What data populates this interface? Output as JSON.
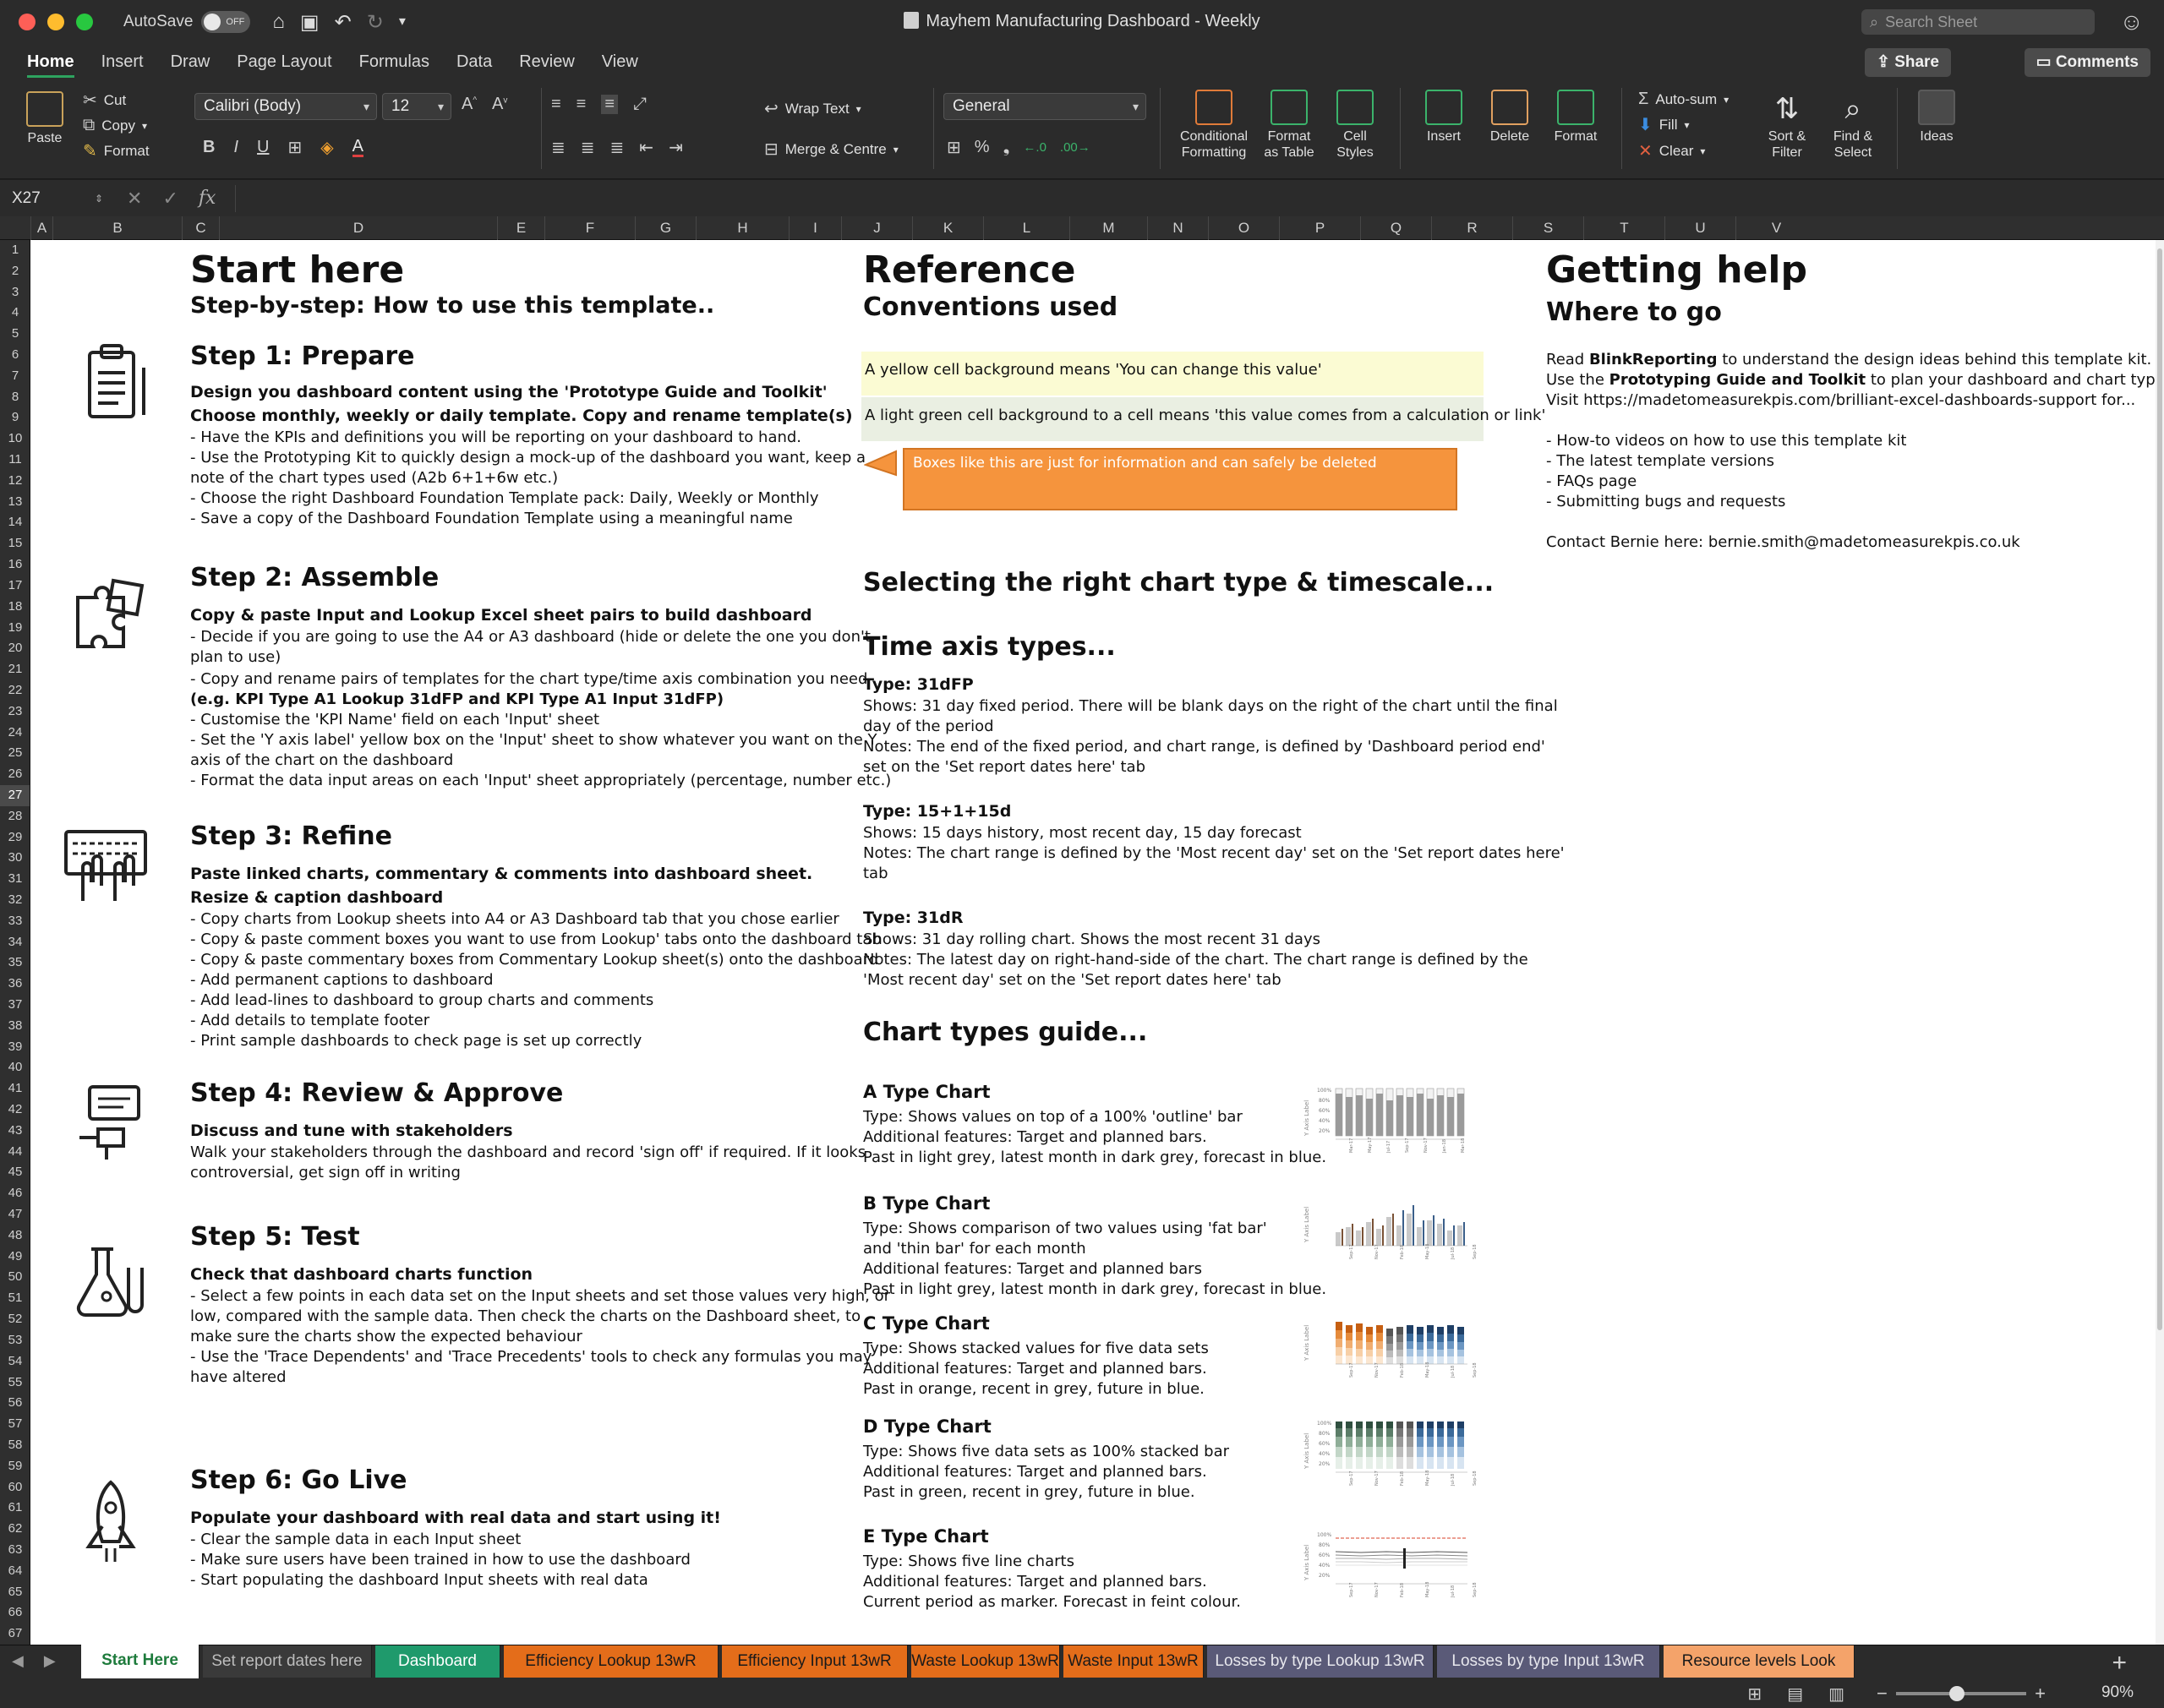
{
  "window": {
    "title": "Mayhem Manufacturing Dashboard - Weekly",
    "autosave_label": "AutoSave",
    "autosave_state": "OFF",
    "search_placeholder": "Search Sheet"
  },
  "ribbon_tabs": [
    "Home",
    "Insert",
    "Draw",
    "Page Layout",
    "Formulas",
    "Data",
    "Review",
    "View"
  ],
  "ribbon_buttons": {
    "share": "Share",
    "comments": "Comments"
  },
  "ribbon": {
    "paste": "Paste",
    "cut": "Cut",
    "copy": "Copy",
    "format_painter": "Format",
    "font_name": "Calibri (Body)",
    "font_size": "12",
    "wrap_text": "Wrap Text",
    "merge_centre": "Merge & Centre",
    "number_format": "General",
    "percent": "%",
    "conditional_formatting": "Conditional\nFormatting",
    "conditional_formatting_l1": "Conditional",
    "conditional_formatting_l2": "Formatting",
    "format_as_table_l1": "Format",
    "format_as_table_l2": "as Table",
    "cell_styles_l1": "Cell",
    "cell_styles_l2": "Styles",
    "insert": "Insert",
    "delete": "Delete",
    "format": "Format",
    "autosum": "Auto-sum",
    "fill": "Fill",
    "clear": "Clear",
    "sort_filter_l1": "Sort &",
    "sort_filter_l2": "Filter",
    "find_select_l1": "Find &",
    "find_select_l2": "Select",
    "ideas": "Ideas"
  },
  "formula_bar": {
    "name_box": "X27",
    "fx": "fx",
    "formula": ""
  },
  "columns": [
    "A",
    "B",
    "C",
    "D",
    "E",
    "F",
    "G",
    "H",
    "I",
    "J",
    "K",
    "L",
    "M",
    "N",
    "O",
    "P",
    "Q",
    "R",
    "S",
    "T",
    "U",
    "V"
  ],
  "rows": [
    "1",
    "2",
    "3",
    "4",
    "5",
    "6",
    "7",
    "8",
    "9",
    "10",
    "11",
    "12",
    "13",
    "14",
    "15",
    "16",
    "17",
    "18",
    "19",
    "20",
    "21",
    "22",
    "23",
    "24",
    "25",
    "26",
    "27",
    "28",
    "29",
    "30",
    "31",
    "32",
    "33",
    "34",
    "35",
    "36",
    "37",
    "38",
    "39",
    "40",
    "41",
    "42",
    "43",
    "44",
    "45",
    "46",
    "47",
    "48",
    "49",
    "50",
    "51",
    "52",
    "53",
    "54",
    "55",
    "56",
    "57",
    "58",
    "59",
    "60",
    "61",
    "62",
    "63",
    "64",
    "65",
    "66",
    "67"
  ],
  "start": {
    "title": "Start here",
    "subtitle": "Step-by-step: How to use this template..",
    "steps": [
      {
        "title": "Step 1: Prepare",
        "bold_lines": [
          "Design you dashboard content using the 'Prototype Guide and Toolkit'",
          "Choose monthly, weekly or daily template. Copy and rename template(s)"
        ],
        "lines": [
          "- Have the KPIs and definitions you will be reporting on your dashboard to hand.",
          "- Use the Prototyping Kit to quickly design a mock-up of the dashboard you want, keep a",
          "note of the chart types used (A2b 6+1+6w etc.)",
          "- Choose the right Dashboard Foundation Template pack: Daily, Weekly or Monthly",
          "- Save a copy of the Dashboard Foundation Template using a meaningful name"
        ]
      },
      {
        "title": "Step 2: Assemble",
        "bold_lines": [
          "Copy & paste Input and Lookup Excel sheet pairs to build dashboard"
        ],
        "lines": [
          "- Decide if you are going to use the A4 or A3 dashboard (hide or delete the one you don't",
          "plan to use)",
          "- Copy and rename pairs of templates for the chart type/time axis combination you need",
          "(e.g. KPI Type A1 Lookup 31dFP and KPI Type A1 Input 31dFP)",
          "- Customise the 'KPI Name' field on each 'Input' sheet",
          "- Set the 'Y axis label' yellow box on the 'Input' sheet to show whatever you want on the Y",
          "axis of the chart on the dashboard",
          "- Format the data input areas on each 'Input' sheet appropriately (percentage, number etc.)"
        ]
      },
      {
        "title": "Step 3: Refine",
        "bold_lines": [
          "Paste linked charts, commentary & comments into dashboard sheet.",
          "Resize & caption dashboard"
        ],
        "lines": [
          "- Copy charts from Lookup sheets into A4 or A3 Dashboard tab that you chose earlier",
          "- Copy & paste comment boxes you want to use from  Lookup' tabs onto the dashboard tab",
          "- Copy & paste  commentary boxes from  Commentary Lookup sheet(s) onto the dashboard",
          "- Add permanent captions to dashboard",
          "- Add lead-lines to dashboard to group charts and comments",
          "- Add details to template footer",
          "- Print sample dashboards to check page is set up correctly"
        ]
      },
      {
        "title": "Step 4: Review & Approve",
        "bold_lines": [
          "Discuss and tune with stakeholders"
        ],
        "lines": [
          "Walk your stakeholders through the dashboard and record 'sign off' if required. If it looks",
          "controversial, get sign off in writing"
        ]
      },
      {
        "title": "Step 5: Test",
        "bold_lines": [
          "Check that dashboard charts function"
        ],
        "lines": [
          "- Select a few points in each data set on the Input sheets and set those values very high, or",
          "low, compared with the sample data. Then check the charts on the Dashboard sheet, to",
          "make sure the charts show the expected behaviour",
          "- Use the 'Trace Dependents' and 'Trace Precedents' tools to check any formulas you may",
          "have altered"
        ]
      },
      {
        "title": "Step 6: Go Live",
        "bold_lines": [
          "Populate your dashboard with real data and start using it!"
        ],
        "lines": [
          "- Clear the sample data in each Input sheet",
          "- Make sure users have been trained in how to use the dashboard",
          "- Start populating the dashboard Input sheets with real data"
        ]
      }
    ]
  },
  "reference": {
    "title": "Reference",
    "subtitle": "Conventions used",
    "yellow_text": "A yellow cell background means 'You can change this value'",
    "green_text": "A light green cell background to a cell means 'this value comes from a calculation or link'",
    "callout_text": "Boxes like this are just for information and can safely be deleted",
    "selecting_title": "Selecting the right chart type & timescale...",
    "time_axis_title": "Time axis types...",
    "time_axis": [
      {
        "type_label": "Type: 31dFP",
        "shows_lines": [
          "Shows: 31 day fixed period. There will be blank days on the right of the chart until the final",
          "day of the period"
        ],
        "notes_lines": [
          "Notes: The end of the fixed period, and chart range, is defined by 'Dashboard period end'",
          "set on the 'Set report dates here' tab"
        ]
      },
      {
        "type_label": "Type: 15+1+15d",
        "shows_lines": [
          "Shows: 15 days history, most recent day, 15 day forecast"
        ],
        "notes_lines": [
          "Notes: The chart range is defined by the 'Most recent day' set on the 'Set report dates here'",
          "tab"
        ]
      },
      {
        "type_label": "Type: 31dR",
        "shows_lines": [
          "Shows: 31 day rolling chart. Shows the most recent 31 days"
        ],
        "notes_lines": [
          "Notes: The latest day on right-hand-side of the chart. The chart range is defined by the",
          "'Most recent day' set on the 'Set report dates here' tab"
        ]
      }
    ],
    "chart_guide_title": "Chart types guide...",
    "chart_types": [
      {
        "name": "A Type Chart",
        "lines": [
          "Type: Shows values on top of a 100% 'outline' bar",
          "Additional features: Target and planned bars.",
          "Past in light grey, latest month in dark grey, forecast in blue."
        ]
      },
      {
        "name": "B Type Chart",
        "lines": [
          "Type: Shows comparison of two values using 'fat bar'",
          "and 'thin bar' for each month",
          "Additional features: Target and planned bars",
          "Past in light grey, latest month in dark grey, forecast in blue."
        ]
      },
      {
        "name": "C Type Chart",
        "lines": [
          "Type: Shows stacked values for five data sets",
          "Additional features: Target and planned bars.",
          "Past in orange, recent in grey, future in blue."
        ]
      },
      {
        "name": "D Type Chart",
        "lines": [
          "Type: Shows five data sets as 100% stacked bar",
          "Additional features: Target and planned bars.",
          "Past in green, recent in grey, future in blue."
        ]
      },
      {
        "name": "E Type Chart",
        "lines": [
          "Type: Shows five line charts",
          "Additional features: Target and planned bars.",
          "Current period as marker. Forecast in feint colour."
        ]
      }
    ]
  },
  "help": {
    "title": "Getting help",
    "subtitle": "Where to go",
    "line1_prefix": "Read ",
    "line1_bold": "BlinkReporting",
    "line1_suffix": " to understand the design ideas behind this template kit.",
    "line2_prefix": "Use the ",
    "line2_bold": "Prototyping Guide and Toolkit",
    "line2_suffix": " to plan your dashboard and chart types.",
    "line3": "Visit https://madetomeasurekpis.com/brilliant-excel-dashboards-support  for...",
    "bullets": [
      "- How-to videos on how to use this template kit",
      "- The latest template versions",
      "- FAQs page",
      "- Submitting bugs and requests"
    ],
    "contact": "Contact Bernie here: bernie.smith@madetomeasurekpis.co.uk"
  },
  "sheet_tabs": [
    {
      "label": "Start Here",
      "color": "#ffffff",
      "text": "#1e7b3c",
      "active": true
    },
    {
      "label": "Set report dates here",
      "color": "#3a3a3a",
      "text": "#bdbdbd",
      "active": false
    },
    {
      "label": "Dashboard",
      "color": "#1f9a6c",
      "text": "#ffffff",
      "active": false
    },
    {
      "label": "Efficiency Lookup 13wR",
      "color": "#e46d1a",
      "text": "#1a1a1a",
      "active": false
    },
    {
      "label": "Efficiency Input  13wR",
      "color": "#e46d1a",
      "text": "#1a1a1a",
      "active": false
    },
    {
      "label": "Waste Lookup 13wR",
      "color": "#e46d1a",
      "text": "#1a1a1a",
      "active": false
    },
    {
      "label": "Waste Input 13wR",
      "color": "#e46d1a",
      "text": "#1a1a1a",
      "active": false
    },
    {
      "label": "Losses by type Lookup 13wR",
      "color": "#5a5a78",
      "text": "#e8e8ee",
      "active": false
    },
    {
      "label": "Losses by type Input 13wR",
      "color": "#5a5a78",
      "text": "#e8e8ee",
      "active": false
    },
    {
      "label": "Resource levels Look",
      "color": "#f4a36a",
      "text": "#1a1a1a",
      "active": false
    }
  ],
  "status": {
    "zoom": "90%",
    "zoom_level": 0.45
  }
}
